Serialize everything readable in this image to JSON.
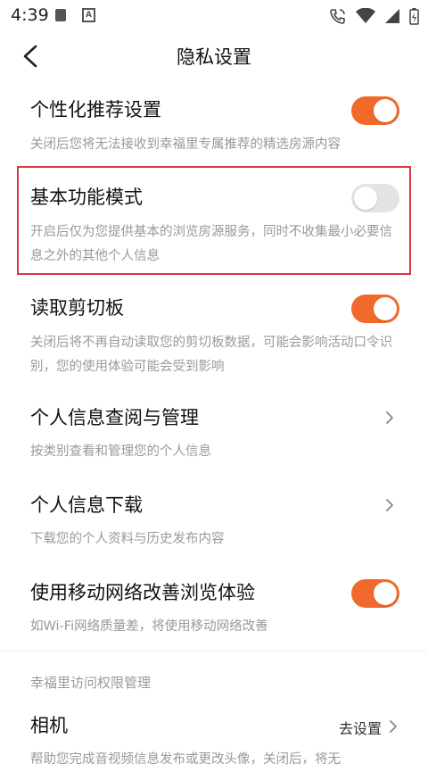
{
  "status": {
    "time": "4:39"
  },
  "header": {
    "title": "隐私设置"
  },
  "items": [
    {
      "title": "个性化推荐设置",
      "desc": "关闭后您将无法接收到幸福里专属推荐的精选房源内容",
      "toggle": true
    },
    {
      "title": "基本功能模式",
      "desc": "开启后仅为您提供基本的浏览房源服务，同时不收集最小必要信息之外的其他个人信息",
      "toggle": false
    },
    {
      "title": "读取剪切板",
      "desc": "关闭后将不再自动读取您的剪切板数据，可能会影响活动口令识别，您的使用体验可能会受到影响",
      "toggle": true
    },
    {
      "title": "个人信息查阅与管理",
      "desc": "按类别查看和管理您的个人信息"
    },
    {
      "title": "个人信息下载",
      "desc": "下载您的个人资料与历史发布内容"
    },
    {
      "title": "使用移动网络改善浏览体验",
      "desc": "如Wi-Fi网络质量差，将使用移动网络改善",
      "toggle": true
    }
  ],
  "section": {
    "title": "幸福里访问权限管理"
  },
  "camera": {
    "title": "相机",
    "action": "去设置",
    "desc": "帮助您完成音视频信息发布或更改头像，关闭后，将无"
  }
}
